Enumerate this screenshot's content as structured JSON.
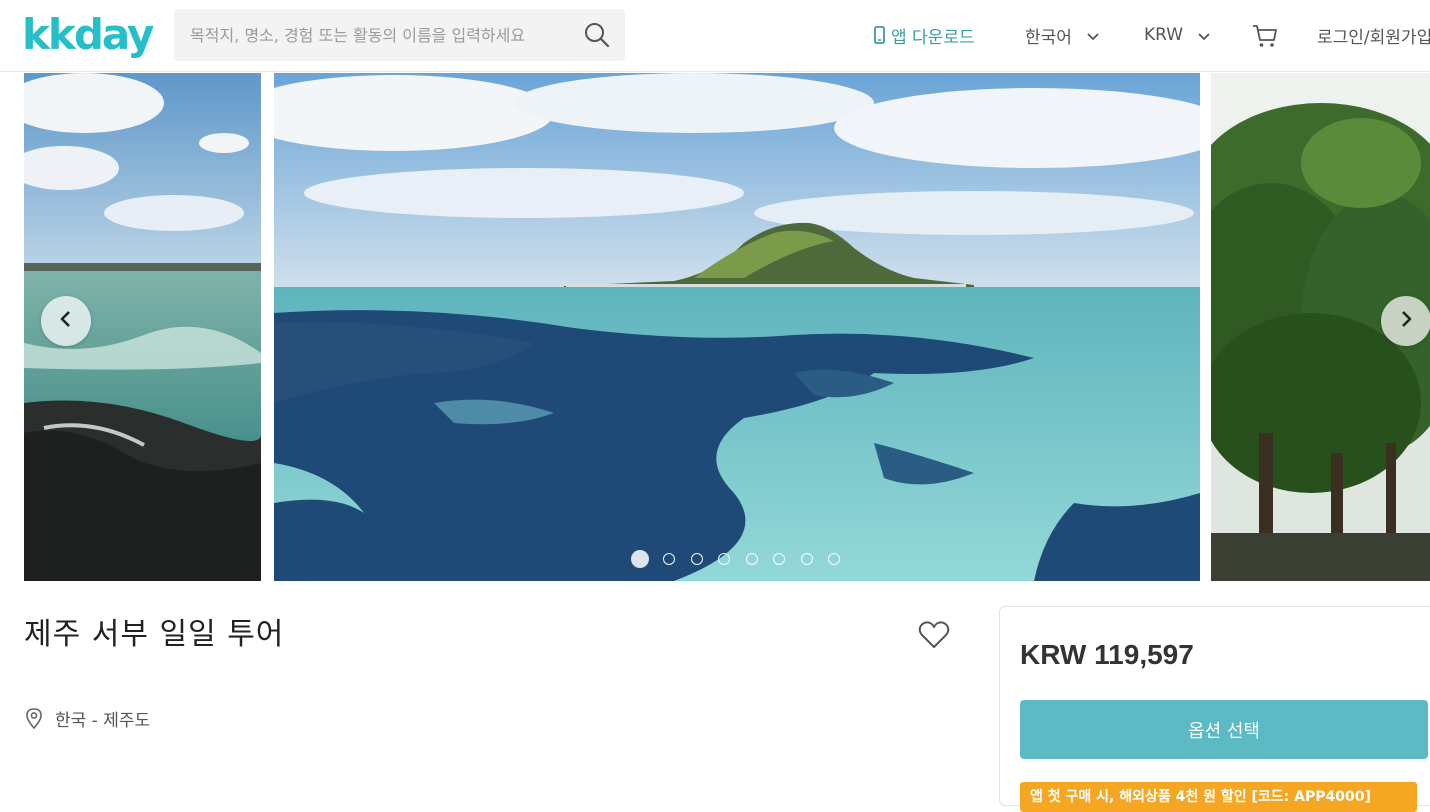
{
  "header": {
    "logo": "kkday",
    "search": {
      "placeholder": "목적지, 명소, 경험 또는 활동의 이름을 입력하세요"
    },
    "app_download": "앱 다운로드",
    "language": "한국어",
    "currency": "KRW",
    "login": "로그인/회원가입"
  },
  "carousel": {
    "slide_count": 8,
    "active_index": 0
  },
  "product": {
    "title": "제주 서부 일일 투어",
    "location": "한국 - 제주도"
  },
  "booking": {
    "price": "KRW 119,597",
    "option_button": "옵션 선택",
    "promo": "앱 첫 구매 시, 해외상품 4천 원 할인 [코드: APP4000]"
  },
  "colors": {
    "brand": "#26bec9",
    "button": "#5cbac5",
    "promo": "#f5a623"
  },
  "icons": {
    "search": "search-icon",
    "phone": "phone-icon",
    "chevron": "chevron-down-icon",
    "cart": "cart-icon",
    "heart": "heart-icon",
    "pin": "map-pin-icon",
    "prev": "chevron-left-icon",
    "next": "chevron-right-icon"
  }
}
